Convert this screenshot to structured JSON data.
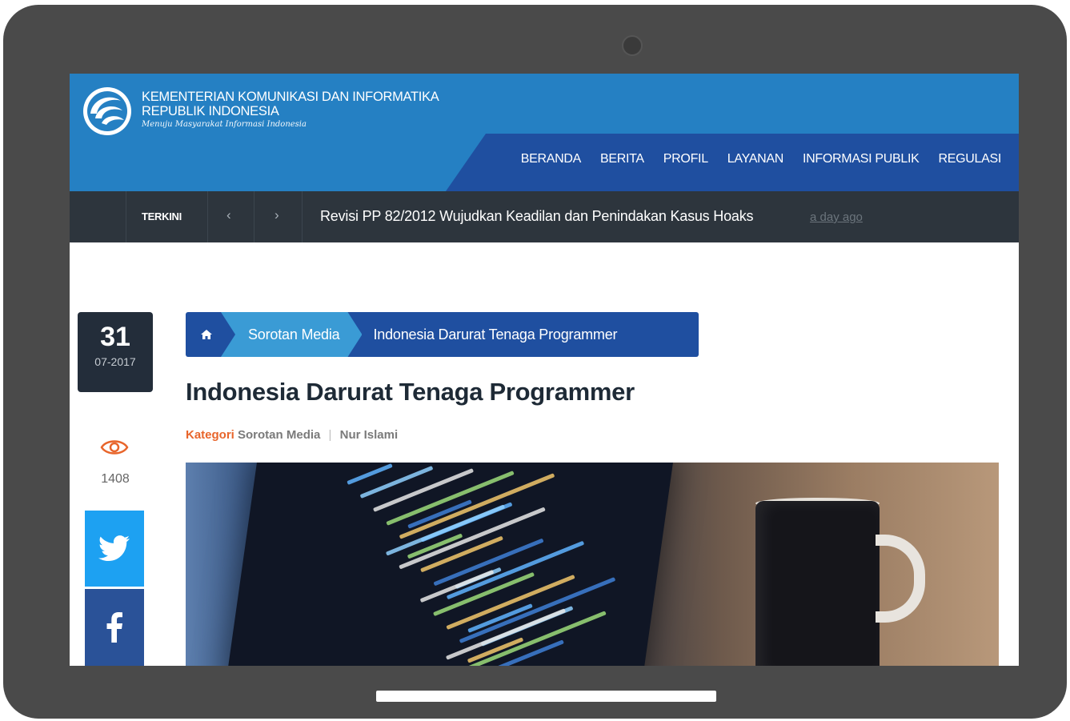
{
  "header": {
    "org_line1": "KEMENTERIAN KOMUNIKASI DAN INFORMATIKA",
    "org_line2": "REPUBLIK INDONESIA",
    "tagline": "Menuju Masyarakat Informasi Indonesia",
    "nav": [
      {
        "label": "BERANDA"
      },
      {
        "label": "BERITA"
      },
      {
        "label": "PROFIL"
      },
      {
        "label": "LAYANAN"
      },
      {
        "label": "INFORMASI PUBLIK"
      },
      {
        "label": "REGULASI"
      }
    ]
  },
  "ticker": {
    "label": "TERKINI",
    "prev_icon": "chevron-left-icon",
    "next_icon": "chevron-right-icon",
    "headline": "Revisi PP 82/2012 Wujudkan Keadilan dan Penindakan Kasus Hoaks",
    "time": "a day ago"
  },
  "post_meta": {
    "day": "31",
    "month_year": "07-2017",
    "views_icon": "eye-icon",
    "views": "1408",
    "share_icons": [
      "twitter-icon",
      "facebook-icon"
    ]
  },
  "breadcrumb": {
    "home_icon": "home-icon",
    "section": "Sorotan Media",
    "current": "Indonesia Darurat Tenaga Programmer"
  },
  "article": {
    "title": "Indonesia Darurat Tenaga Programmer",
    "category_label": "Kategori",
    "category": "Sorotan Media",
    "author": "Nur Islami"
  },
  "colors": {
    "header_blue": "#2580c3",
    "nav_dark_blue": "#1f4fa0",
    "ticker_bg": "#2d353d",
    "accent_orange": "#e8652b",
    "twitter": "#1da1f2",
    "facebook": "#2a5298"
  }
}
